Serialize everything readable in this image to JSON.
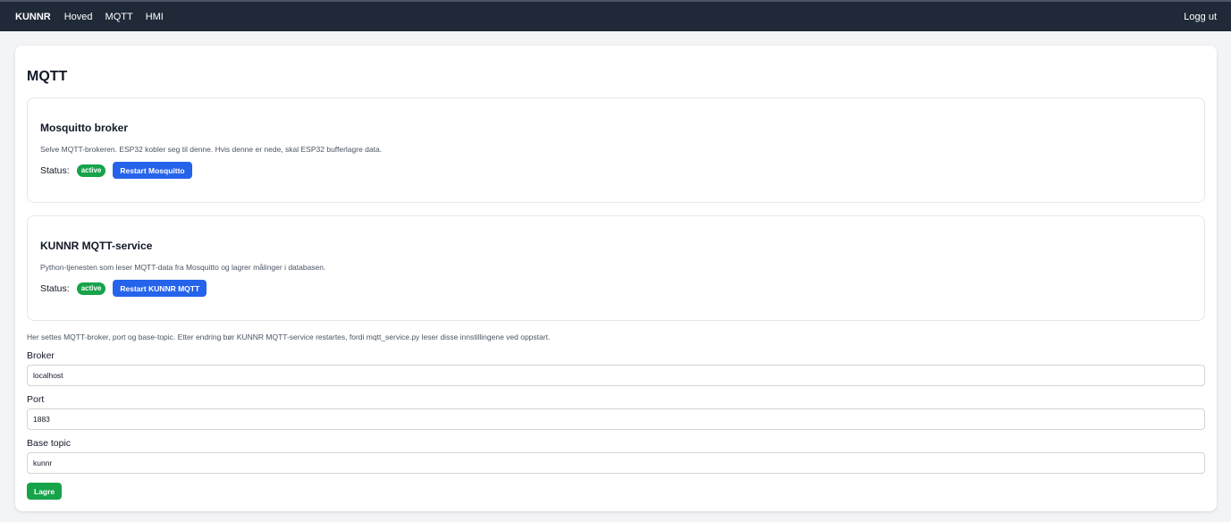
{
  "nav": {
    "brand": "KUNNR",
    "links": [
      "Hoved",
      "MQTT",
      "HMI"
    ],
    "logout": "Logg ut"
  },
  "page": {
    "title": "MQTT"
  },
  "services": [
    {
      "title": "Mosquitto broker",
      "description": "Selve MQTT-brokeren. ESP32 kobler seg til denne. Hvis denne er nede, skal ESP32 bufferlagre data.",
      "status_label": "Status:",
      "status": "active",
      "button": "Restart Mosquitto"
    },
    {
      "title": "KUNNR MQTT-service",
      "description": "Python-tjenesten som leser MQTT-data fra Mosquitto og lagrer målinger i databasen.",
      "status_label": "Status:",
      "status": "active",
      "button": "Restart KUNNR MQTT"
    }
  ],
  "settings": {
    "note": "Her settes MQTT-broker, port og base-topic. Etter endring bør KUNNR MQTT-service restartes, fordi mqtt_service.py leser disse innstillingene ved oppstart.",
    "broker_label": "Broker",
    "broker_value": "localhost",
    "port_label": "Port",
    "port_value": "1883",
    "topic_label": "Base topic",
    "topic_value": "kunnr",
    "save_button": "Lagre"
  },
  "colors": {
    "navbar": "#1f2937",
    "primary": "#2563eb",
    "success": "#16a34a"
  }
}
